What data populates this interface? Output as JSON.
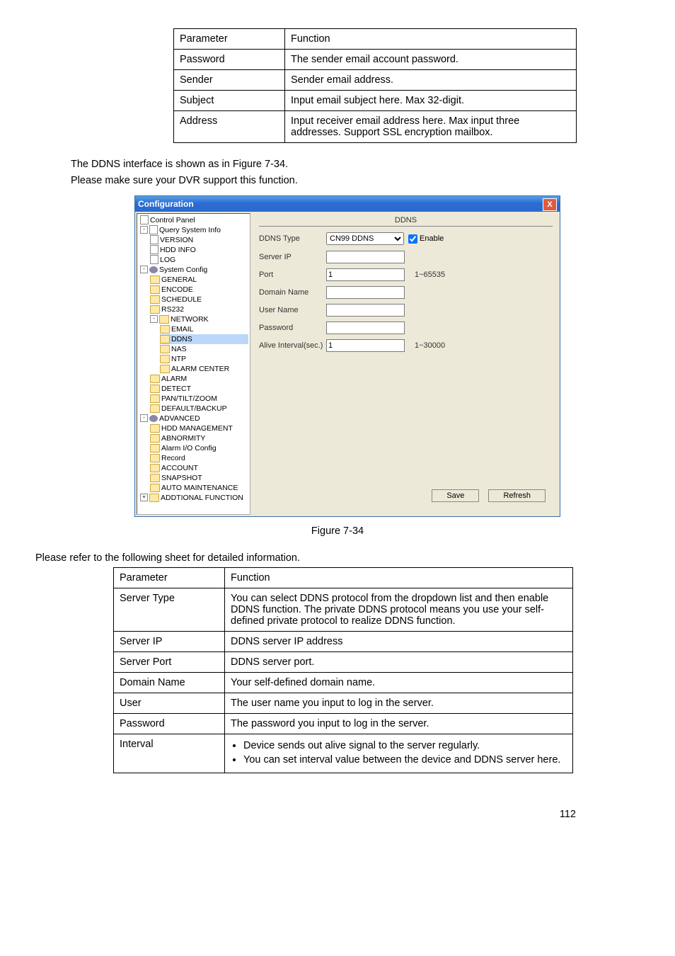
{
  "table1": {
    "h1": "Parameter",
    "h2": "Function",
    "rows": [
      {
        "p": "Password",
        "f": "The sender email account password."
      },
      {
        "p": "Sender",
        "f": "Sender email address."
      },
      {
        "p": "Subject",
        "f": "Input email subject here. Max 32-digit."
      },
      {
        "p": "Address",
        "f": "Input receiver email address here. Max input three addresses. Support SSL encryption mailbox."
      }
    ]
  },
  "intro1": "The DDNS interface is shown as in Figure 7-34.",
  "intro2": "Please make sure your DVR support this function.",
  "config": {
    "title": "Configuration",
    "close": "X",
    "tree": {
      "root": "Control Panel",
      "qsi": "Query System Info",
      "version": "VERSION",
      "hddinfo": "HDD INFO",
      "log": "LOG",
      "sysconfig": "System Config",
      "general": "GENERAL",
      "encode": "ENCODE",
      "schedule": "SCHEDULE",
      "rs232": "RS232",
      "network": "NETWORK",
      "email": "EMAIL",
      "ddns": "DDNS",
      "nas": "NAS",
      "ntp": "NTP",
      "alarmcenter": "ALARM CENTER",
      "alarm": "ALARM",
      "detect": "DETECT",
      "ptz": "PAN/TILT/ZOOM",
      "defaultbackup": "DEFAULT/BACKUP",
      "advanced": "ADVANCED",
      "hddmgmt": "HDD MANAGEMENT",
      "abnormity": "ABNORMITY",
      "alarmio": "Alarm I/O Config",
      "record": "Record",
      "account": "ACCOUNT",
      "snapshot": "SNAPSHOT",
      "automaint": "AUTO MAINTENANCE",
      "addfunc": "ADDTIONAL FUNCTION"
    },
    "panel": {
      "title": "DDNS",
      "ddnstype_lbl": "DDNS Type",
      "ddnstype_val": "CN99 DDNS",
      "enable_lbl": "Enable",
      "serverip_lbl": "Server IP",
      "serverip_val": "",
      "port_lbl": "Port",
      "port_val": "1",
      "port_hint": "1~65535",
      "domain_lbl": "Domain Name",
      "domain_val": "",
      "user_lbl": "User Name",
      "user_val": "",
      "password_lbl": "Password",
      "password_val": "",
      "alive_lbl": "Alive Interval(sec.)",
      "alive_val": "1",
      "alive_hint": "1~30000",
      "save": "Save",
      "refresh": "Refresh"
    }
  },
  "figcap": "Figure 7-34",
  "intro3": "Please refer to the following sheet for detailed information.",
  "table2": {
    "h1": "Parameter",
    "h2": "Function",
    "rows": [
      {
        "p": "Server Type",
        "f": "You can select DDNS protocol from the dropdown list and then enable DDNS function. The private DDNS protocol means you use your self-defined private protocol to realize DDNS function."
      },
      {
        "p": "Server IP",
        "f": "DDNS server IP address"
      },
      {
        "p": "Server Port",
        "f": "DDNS server port."
      },
      {
        "p": "Domain Name",
        "f": "Your self-defined domain name."
      },
      {
        "p": "User",
        "f": "The user name you input to log in the server."
      },
      {
        "p": "Password",
        "f": "The password you input to log in the server."
      }
    ],
    "interval_p": "Interval",
    "interval_b1": "Device sends out alive signal to the server regularly.",
    "interval_b2": "You can set interval value between the device and DDNS server here."
  },
  "pagenum": "112"
}
